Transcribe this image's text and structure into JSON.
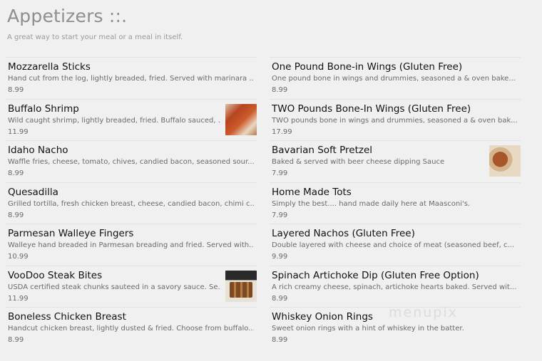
{
  "header": {
    "title": "Appetizers ::.",
    "subtitle": "A great way to start your meal or a meal in itself."
  },
  "left": [
    {
      "name": "Mozzarella Sticks",
      "desc": "Hand cut from the log, lightly breaded, fried. Served with marinara ...",
      "price": "8.99"
    },
    {
      "name": "Buffalo Shrimp",
      "desc": "Wild caught shrimp, lightly breaded, fried. Buffalo sauced, ...",
      "price": "11.99"
    },
    {
      "name": "Idaho Nacho",
      "desc": "Waffle fries, cheese, tomato, chives, candied bacon, seasoned sour...",
      "price": "8.99"
    },
    {
      "name": "Quesadilla",
      "desc": "Grilled tortilla, fresh chicken breast, cheese, candied bacon, chimi c...",
      "price": "8.99"
    },
    {
      "name": "Parmesan Walleye Fingers",
      "desc": "Walleye hand breaded in Parmesan breading and fried. Served with...",
      "price": "10.99"
    },
    {
      "name": "VooDoo Steak Bites",
      "desc": "USDA certified steak chunks sauteed in a savory sauce. Se...",
      "price": "11.99"
    },
    {
      "name": "Boneless Chicken Breast",
      "desc": "Handcut chicken breast, lightly dusted & fried. Choose from buffalo...",
      "price": "8.99"
    }
  ],
  "right": [
    {
      "name": "One Pound Bone-in Wings (Gluten Free)",
      "desc": "One pound bone in wings and drummies, seasoned a & oven bake...",
      "price": "8.99"
    },
    {
      "name": "TWO Pounds Bone-In Wings (Gluten Free)",
      "desc": "TWO pounds bone in wings and drummies, seasoned a & oven bak...",
      "price": "17.99"
    },
    {
      "name": "Bavarian Soft Pretzel",
      "desc": "Baked & served with beer cheese dipping Sauce",
      "price": "7.99"
    },
    {
      "name": "Home Made Tots",
      "desc": "Simply the best.... hand made daily here at Maasconi's.",
      "price": "7.99"
    },
    {
      "name": "Layered Nachos (Gluten Free)",
      "desc": "Double layered with cheese and choice of meat (seasoned beef, c...",
      "price": "9.99"
    },
    {
      "name": "Spinach Artichoke Dip (Gluten Free Option)",
      "desc": "A rich creamy cheese, spinach, artichoke hearts baked. Served wit...",
      "price": "8.99"
    },
    {
      "name": "Whiskey Onion Rings",
      "desc": "Sweet onion rings with a hint of whiskey in the batter.",
      "price": "8.99"
    }
  ],
  "watermark": "menupix"
}
